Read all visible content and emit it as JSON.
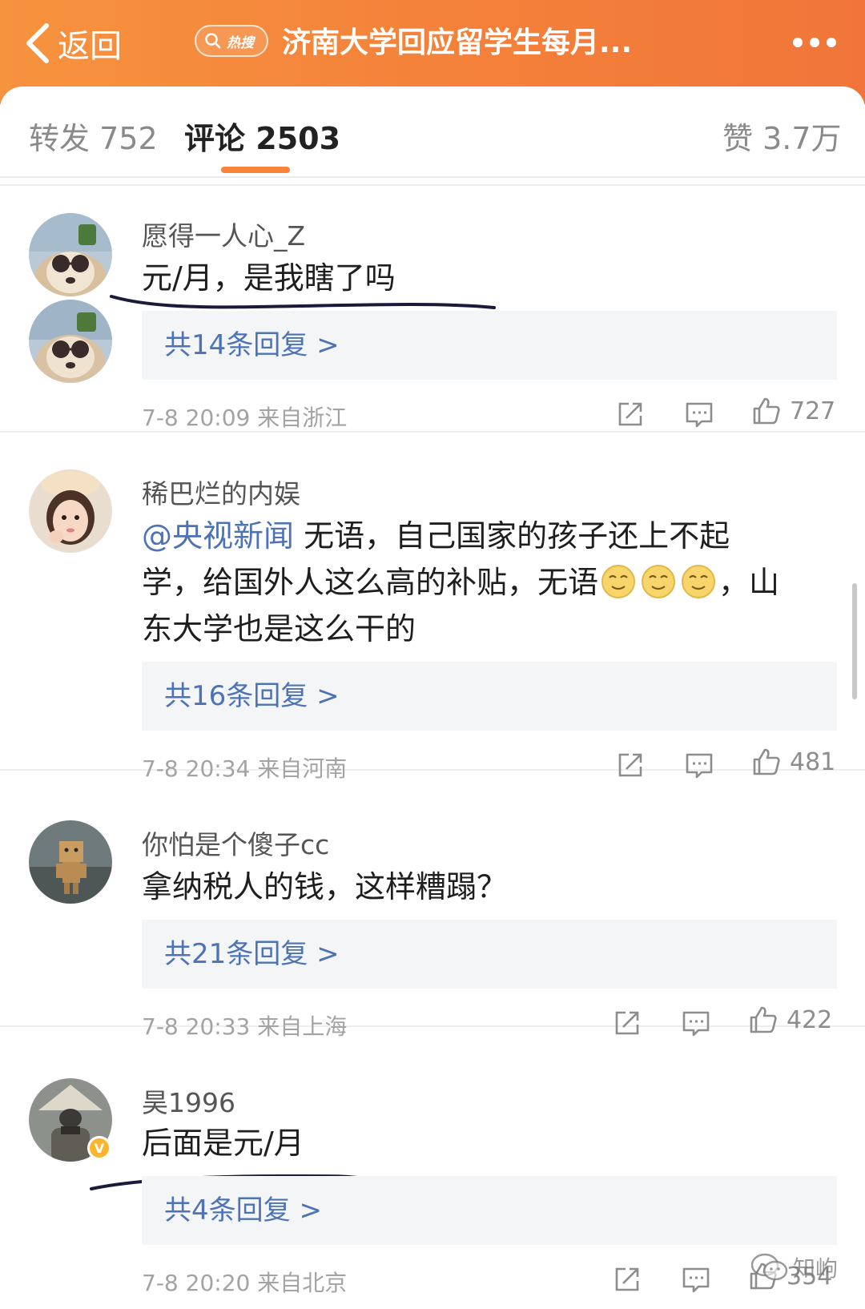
{
  "header": {
    "back_label": "返回",
    "hot_badge": "热搜",
    "title": "济南大学回应留学生每月..."
  },
  "tabs": [
    {
      "label": "转发",
      "count": "752"
    },
    {
      "label": "评论",
      "count": "2503",
      "active": true
    },
    {
      "label": "赞",
      "count": "3.7万"
    }
  ],
  "comments": [
    {
      "username": "愿得一人心_Z",
      "text": "元/月，是我瞎了吗",
      "replies": "共14条回复 >",
      "time": "7-8 20:09",
      "location": "来自浙江",
      "likes": "727"
    },
    {
      "username": "稀巴烂的内娱",
      "mention": "@央视新闻",
      "text_line1": " 无语，自己国家的孩子还上不起",
      "text_line2a": "学，给国外人这么高的补贴，无语",
      "text_line2b": "，山",
      "text_line3": "东大学也是这么干的",
      "replies": "共16条回复 >",
      "time": "7-8 20:34",
      "location": "来自河南",
      "likes": "481"
    },
    {
      "username": "你怕是个傻子cc",
      "text": "拿纳税人的钱，这样糟蹋？",
      "replies": "共21条回复 >",
      "time": "7-8 20:33",
      "location": "来自上海",
      "likes": "422"
    },
    {
      "username": "昊1996",
      "text": "后面是元/月",
      "replies": "共4条回复 >",
      "time": "7-8 20:20",
      "location": "来自北京",
      "likes": "354",
      "verified_badge": "V"
    }
  ],
  "watermark": "知岣",
  "colors": {
    "header_orange": "#f4823a",
    "link_blue": "#4d73b6",
    "tab_indicator": "#f6853a",
    "reply_bg": "#f4f5f7"
  }
}
